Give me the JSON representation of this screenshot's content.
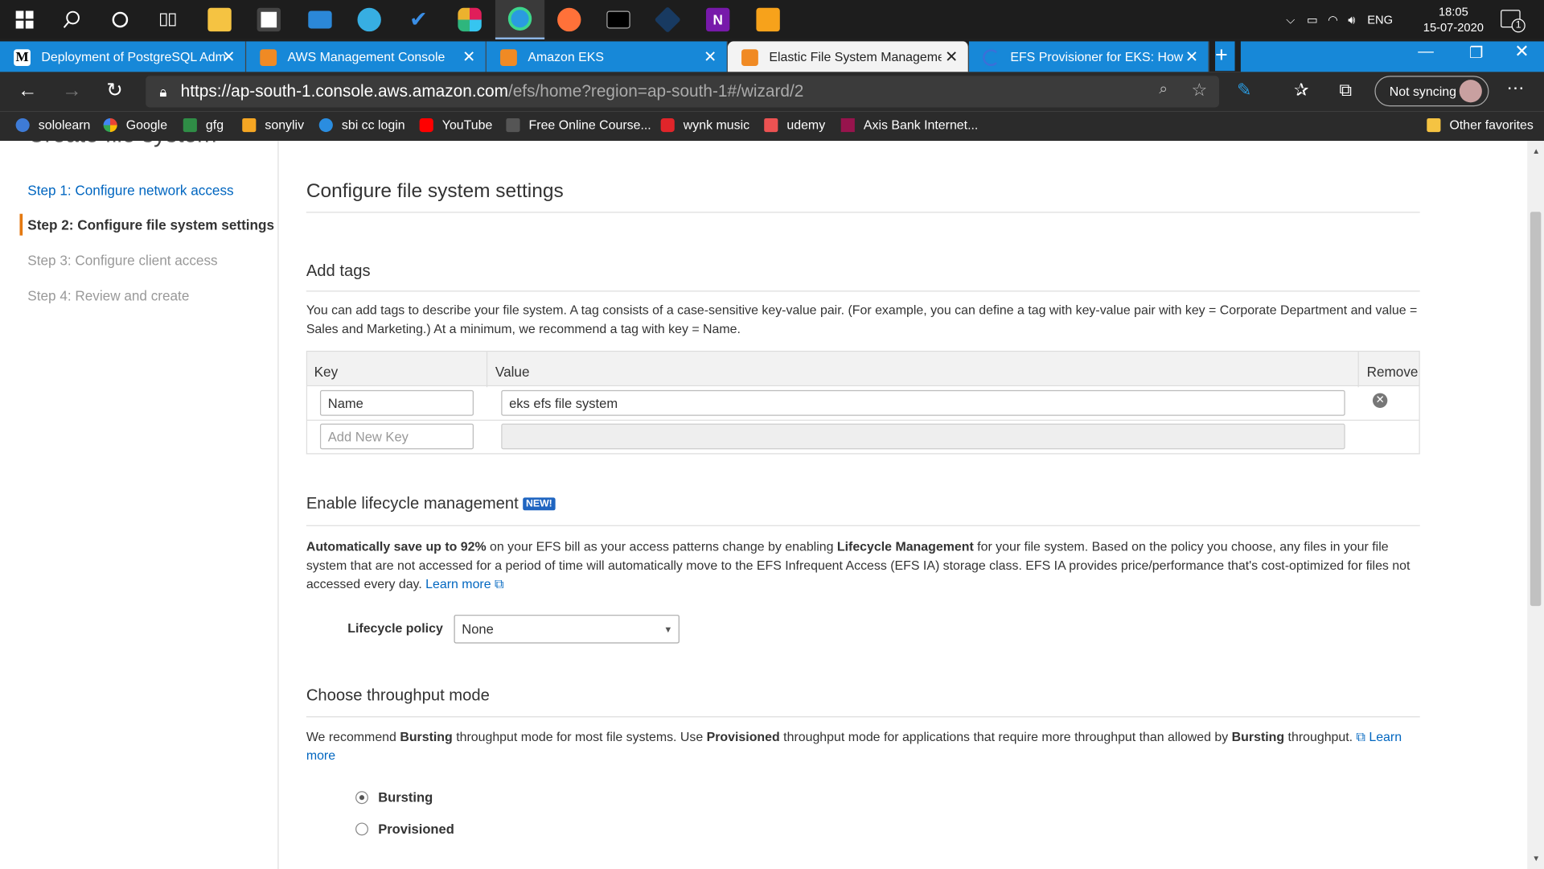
{
  "taskbar": {
    "time": "18:05",
    "date": "15-07-2020",
    "lang": "ENG",
    "notif_count": "1"
  },
  "tabs": [
    {
      "label": "Deployment of PostgreSQL Adm",
      "fav_color": "#000"
    },
    {
      "label": "AWS Management Console",
      "fav_color": "#f08a24"
    },
    {
      "label": "Amazon EKS",
      "fav_color": "#f08a24"
    },
    {
      "label": "Elastic File System Management",
      "fav_color": "#f08a24"
    },
    {
      "label": "EFS Provisioner for EKS: How it W",
      "fav_color": "#3b6fd8"
    }
  ],
  "address": {
    "host": "https://ap-south-1.console.aws.amazon.com",
    "path": "/efs/home?region=ap-south-1#/wizard/2",
    "sync": "Not syncing"
  },
  "bookmarks": [
    "sololearn",
    "Google",
    "gfg",
    "sonyliv",
    "sbi cc login",
    "YouTube",
    "Free Online Course...",
    "wynk music",
    "udemy",
    "Axis Bank Internet..."
  ],
  "other_favorites": "Other favorites",
  "header_title": "Create file system",
  "steps": [
    "Step 1: Configure network access",
    "Step 2: Configure file system settings",
    "Step 3: Configure client access",
    "Step 4: Review and create"
  ],
  "main": {
    "title": "Configure file system settings",
    "tags": {
      "title": "Add tags",
      "desc": "You can add tags to describe your file system. A tag consists of a case-sensitive key-value pair. (For example, you can define a tag with key-value pair with key = Corporate Department and value = Sales and Marketing.) At a minimum, we recommend a tag with key = Name.",
      "col_key": "Key",
      "col_value": "Value",
      "col_remove": "Remove",
      "row_key": "Name",
      "row_value": "eks efs file system",
      "new_key_placeholder": "Add New Key"
    },
    "lifecycle": {
      "title": "Enable lifecycle management",
      "badge": "NEW!",
      "bold1": "Automatically save up to 92%",
      "text1": " on your EFS bill as your access patterns change by enabling ",
      "bold2": "Lifecycle Management",
      "text2": " for your file system. Based on the policy you choose, any files in your file system that are not accessed for a period of time will automatically move to the EFS Infrequent Access (EFS IA) storage class. EFS IA provides price/performance that's cost-optimized for files not accessed every day. ",
      "link": "Learn more",
      "policy_label": "Lifecycle policy",
      "policy_value": "None"
    },
    "throughput": {
      "title": "Choose throughput mode",
      "t1": "We recommend ",
      "b1": "Bursting",
      "t2": " throughput mode for most file systems. Use ",
      "b2": "Provisioned",
      "t3": " throughput mode for applications that require more throughput than allowed by ",
      "b3": "Bursting",
      "t4": " throughput. ",
      "link1": "Learn",
      "link2": "more",
      "opt1": "Bursting",
      "opt2": "Provisioned"
    }
  }
}
